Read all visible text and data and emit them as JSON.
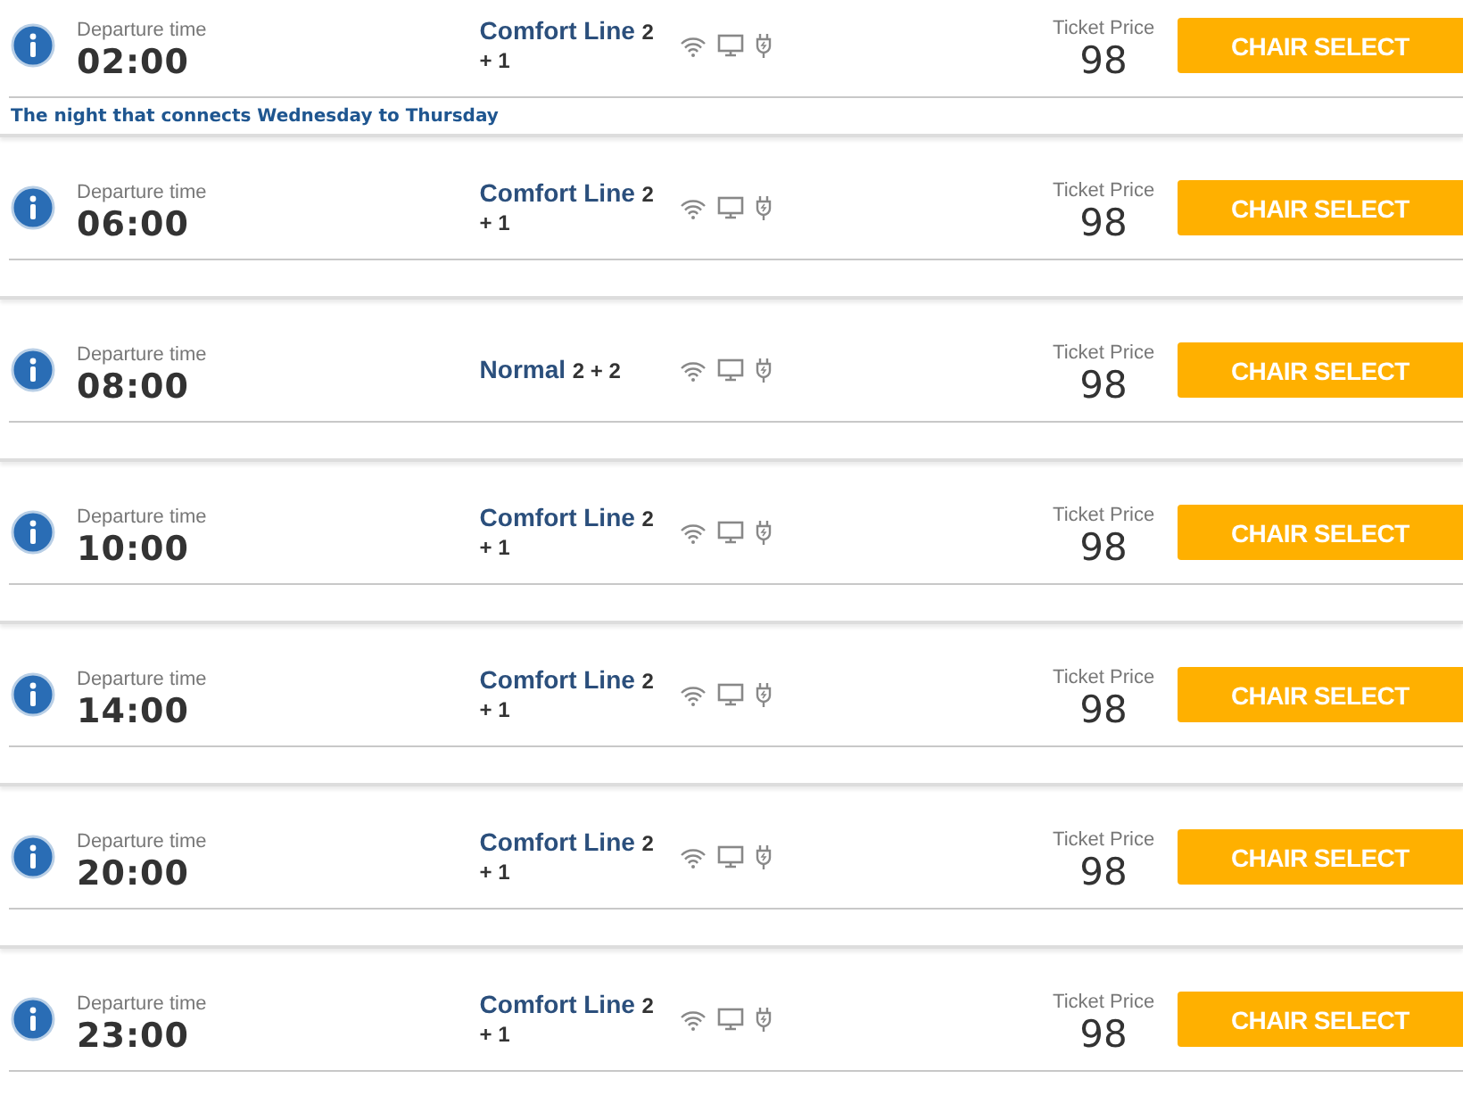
{
  "trips": [
    {
      "departure_label": "Departure time",
      "time": "02:00",
      "class_name": "Comfort Line",
      "seats": "2 + 1",
      "price_label": "Ticket Price",
      "price": "98",
      "button": "CHAIR SELECT",
      "note": "The night that connects Wednesday to Thursday"
    },
    {
      "departure_label": "Departure time",
      "time": "06:00",
      "class_name": "Comfort Line",
      "seats": "2 + 1",
      "price_label": "Ticket Price",
      "price": "98",
      "button": "CHAIR SELECT"
    },
    {
      "departure_label": "Departure time",
      "time": "08:00",
      "class_name": "Normal",
      "seats": "2 + 2",
      "price_label": "Ticket Price",
      "price": "98",
      "button": "CHAIR SELECT"
    },
    {
      "departure_label": "Departure time",
      "time": "10:00",
      "class_name": "Comfort Line",
      "seats": "2 + 1",
      "price_label": "Ticket Price",
      "price": "98",
      "button": "CHAIR SELECT"
    },
    {
      "departure_label": "Departure time",
      "time": "14:00",
      "class_name": "Comfort Line",
      "seats": "2 + 1",
      "price_label": "Ticket Price",
      "price": "98",
      "button": "CHAIR SELECT"
    },
    {
      "departure_label": "Departure time",
      "time": "20:00",
      "class_name": "Comfort Line",
      "seats": "2 + 1",
      "price_label": "Ticket Price",
      "price": "98",
      "button": "CHAIR SELECT"
    },
    {
      "departure_label": "Departure time",
      "time": "23:00",
      "class_name": "Comfort Line",
      "seats": "2 + 1",
      "price_label": "Ticket Price",
      "price": "98",
      "button": "CHAIR SELECT"
    }
  ]
}
